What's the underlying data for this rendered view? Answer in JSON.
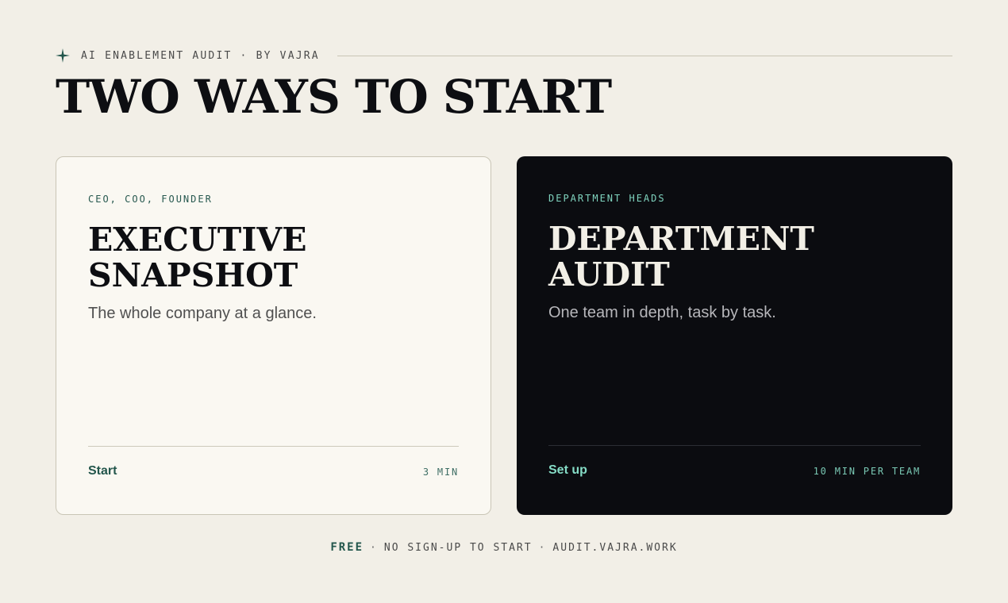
{
  "header": {
    "eyebrow": "AI ENABLEMENT AUDIT · BY VAJRA",
    "headline": "TWO WAYS TO START",
    "icon": "sparkle-icon",
    "accent_color": "#23564c"
  },
  "cards": [
    {
      "tag": "CEO, COO, FOUNDER",
      "title_line1": "EXECUTIVE",
      "title_line2": "SNAPSHOT",
      "description": "The whole company at a glance.",
      "cta": "Start",
      "meta": "3 MIN",
      "theme": "light"
    },
    {
      "tag": "DEPARTMENT HEADS",
      "title_line1": "DEPARTMENT",
      "title_line2": "AUDIT",
      "description": "One team in depth, task by task.",
      "cta": "Set up",
      "meta": "10 MIN PER TEAM",
      "theme": "dark"
    }
  ],
  "footer": {
    "free": "FREE",
    "separator": "·",
    "no_signup": "NO SIGN-UP TO START",
    "url": "AUDIT.VAJRA.WORK"
  }
}
